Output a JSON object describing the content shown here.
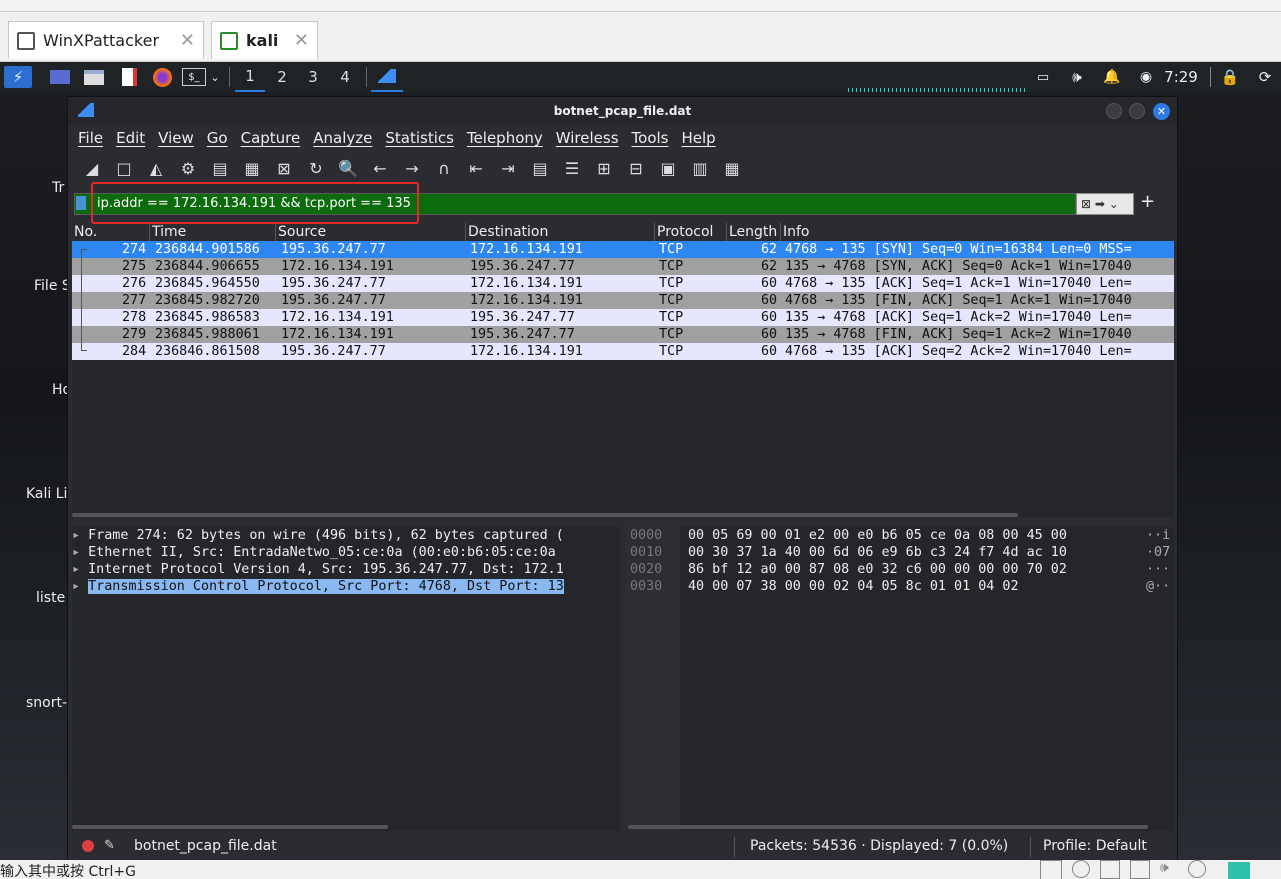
{
  "vm_tabs": [
    {
      "label": "WinXPattacker"
    },
    {
      "label": "kali"
    }
  ],
  "panel": {
    "workspaces": [
      "1",
      "2",
      "3",
      "4"
    ],
    "clock": "7:29"
  },
  "desktop_icons": [
    "Tr",
    "File S",
    "Ho",
    "Kali Li",
    "liste",
    "snort-"
  ],
  "window": {
    "title": "botnet_pcap_file.dat"
  },
  "menu": [
    "File",
    "Edit",
    "View",
    "Go",
    "Capture",
    "Analyze",
    "Statistics",
    "Telephony",
    "Wireless",
    "Tools",
    "Help"
  ],
  "filter": {
    "value": "ip.addr == 172.16.134.191 && tcp.port == 135"
  },
  "columns": [
    "No.",
    "Time",
    "Source",
    "Destination",
    "Protocol",
    "Length",
    "Info"
  ],
  "packets": [
    {
      "no": "274",
      "time": "236844.901586",
      "src": "195.36.247.77",
      "dst": "172.16.134.191",
      "proto": "TCP",
      "len": "62",
      "info": "4768 → 135 [SYN] Seq=0 Win=16384 Len=0 MSS="
    },
    {
      "no": "275",
      "time": "236844.906655",
      "src": "172.16.134.191",
      "dst": "195.36.247.77",
      "proto": "TCP",
      "len": "62",
      "info": "135 → 4768 [SYN, ACK] Seq=0 Ack=1 Win=17040"
    },
    {
      "no": "276",
      "time": "236845.964550",
      "src": "195.36.247.77",
      "dst": "172.16.134.191",
      "proto": "TCP",
      "len": "60",
      "info": "4768 → 135 [ACK] Seq=1 Ack=1 Win=17040 Len="
    },
    {
      "no": "277",
      "time": "236845.982720",
      "src": "195.36.247.77",
      "dst": "172.16.134.191",
      "proto": "TCP",
      "len": "60",
      "info": "4768 → 135 [FIN, ACK] Seq=1 Ack=1 Win=17040"
    },
    {
      "no": "278",
      "time": "236845.986583",
      "src": "172.16.134.191",
      "dst": "195.36.247.77",
      "proto": "TCP",
      "len": "60",
      "info": "135 → 4768 [ACK] Seq=1 Ack=2 Win=17040 Len="
    },
    {
      "no": "279",
      "time": "236845.988061",
      "src": "172.16.134.191",
      "dst": "195.36.247.77",
      "proto": "TCP",
      "len": "60",
      "info": "135 → 4768 [FIN, ACK] Seq=1 Ack=2 Win=17040"
    },
    {
      "no": "284",
      "time": "236846.861508",
      "src": "195.36.247.77",
      "dst": "172.16.134.191",
      "proto": "TCP",
      "len": "60",
      "info": "4768 → 135 [ACK] Seq=2 Ack=2 Win=17040 Len="
    }
  ],
  "details": [
    "Frame 274: 62 bytes on wire (496 bits), 62 bytes captured (",
    "Ethernet II, Src: EntradaNetwo_05:ce:0a (00:e0:b6:05:ce:0a",
    "Internet Protocol Version 4, Src: 195.36.247.77, Dst: 172.1",
    "Transmission Control Protocol, Src Port: 4768, Dst Port: 13"
  ],
  "bytes": [
    {
      "off": "0000",
      "hex": "00 05 69 00 01 e2 00 e0  b6 05 ce 0a 08 00 45 00",
      "ascii": "··i"
    },
    {
      "off": "0010",
      "hex": "00 30 37 1a 40 00 6d 06  e9 6b c3 24 f7 4d ac 10",
      "ascii": "·07"
    },
    {
      "off": "0020",
      "hex": "86 bf 12 a0 00 87 08 e0  32 c6 00 00 00 00 70 02",
      "ascii": "···"
    },
    {
      "off": "0030",
      "hex": "40 00 07 38 00 00 02 04  05 8c 01 01 04 02",
      "ascii": "@··"
    }
  ],
  "status": {
    "file": "botnet_pcap_file.dat",
    "packets": "Packets: 54536 · Displayed: 7 (0.0%)",
    "profile": "Profile: Default"
  },
  "host_bottom": {
    "hint": "输入其中或按 Ctrl+G"
  }
}
